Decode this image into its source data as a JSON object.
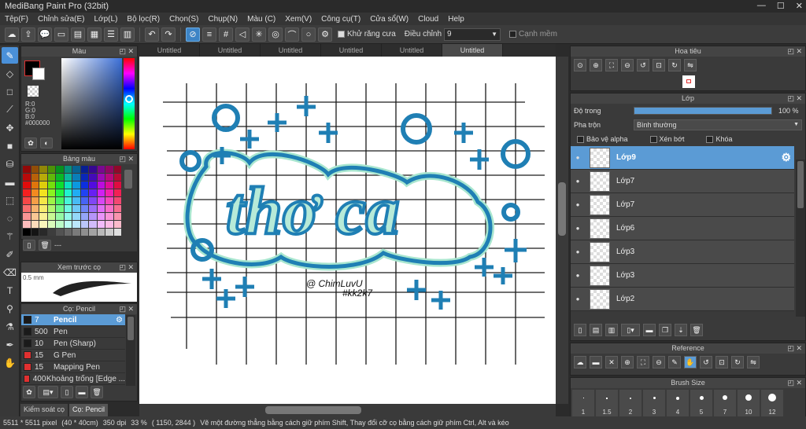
{
  "app": {
    "title": "MediBang Paint Pro (32bit)",
    "min": "—",
    "max": "☐",
    "close": "✕"
  },
  "menu": [
    "Tệp(F)",
    "Chỉnh sửa(E)",
    "Lớp(L)",
    "Bộ lọc(R)",
    "Chọn(S)",
    "Chụp(N)",
    "Màu (C)",
    "Xem(V)",
    "Công cụ(T)",
    "Cửa sổ(W)",
    "Cloud",
    "Help"
  ],
  "toolbar": {
    "antialias_label": "Khử răng cưa",
    "adjust_label": "Điều chỉnh",
    "adjust_value": "9",
    "smooth_label": "Cạnh mềm"
  },
  "color_panel": {
    "title": "Màu",
    "r": "R:0",
    "g": "G:0",
    "b": "B:0",
    "hex": "#000000"
  },
  "palette_panel": {
    "title": "Bảng màu",
    "dash": "---"
  },
  "preview_panel": {
    "title": "Xem trước cọ",
    "size": "0.5 mm"
  },
  "brush_panel": {
    "title": "Cọ: Pencil",
    "items": [
      {
        "size": "7",
        "name": "Pencil",
        "color": "#1a1a1a"
      },
      {
        "size": "500",
        "name": "Pen",
        "color": "#1a1a1a"
      },
      {
        "size": "10",
        "name": "Pen (Sharp)",
        "color": "#1a1a1a"
      },
      {
        "size": "15",
        "name": "G Pen",
        "color": "#e03030"
      },
      {
        "size": "15",
        "name": "Mapping Pen",
        "color": "#e03030"
      },
      {
        "size": "400",
        "name": "Khoảng trống [Edge ...",
        "color": "#e03030"
      }
    ]
  },
  "bottom_tabs": [
    "Kiểm soát cọ",
    "Cọ: Pencil"
  ],
  "canvas_tabs": [
    "Untitled",
    "Untitled",
    "Untitled",
    "Untitled",
    "Untitled",
    "Untitled"
  ],
  "artwork": {
    "main_text": "thơ ca",
    "signature": "@ ChimLuvU",
    "hashtag": "#kk2k7"
  },
  "nav_panel": {
    "title": "Hoa tiêu"
  },
  "layer_panel": {
    "title": "Lớp",
    "opacity_label": "Độ trong",
    "opacity_value": "100 %",
    "opacity_fraction": 1.0,
    "blend_label": "Pha trộn",
    "blend_value": "Bình thường",
    "protect_alpha": "Bảo vệ alpha",
    "clip": "Xén bớt",
    "lock": "Khóa",
    "layers": [
      "Lớp9",
      "Lớp7",
      "Lớp7",
      "Lớp6",
      "Lớp3",
      "Lớp3",
      "Lớp2"
    ]
  },
  "ref_panel": {
    "title": "Reference"
  },
  "brushsize_panel": {
    "title": "Brush Size",
    "sizes": [
      "1",
      "1.5",
      "2",
      "3",
      "4",
      "5",
      "7",
      "10",
      "12"
    ]
  },
  "status": {
    "dims": "5511 * 5511 pixel",
    "cm": "(40 * 40cm)",
    "dpi": "350 dpi",
    "zoom": "33 %",
    "coord": "( 1150, 2844 )",
    "hint": "Vẽ một đường thẳng bằng cách giữ phím Shift, Thay đổi cỡ cọ bằng cách giữ phím Ctrl, Alt và kéo"
  },
  "colors": {
    "accent": "#5b9bd5",
    "art_blue": "#1f7fb4",
    "art_mint": "#a8e6cf"
  }
}
